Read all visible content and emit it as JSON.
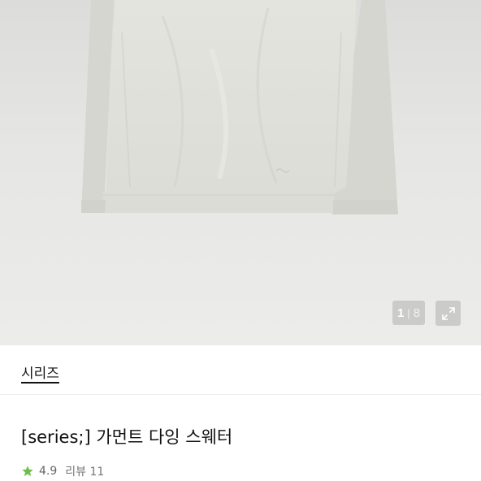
{
  "gallery": {
    "current": "1",
    "separator": "|",
    "total": "8",
    "image_icon": "sweater-product-image",
    "expand_icon": "expand-icon"
  },
  "brand": {
    "name": "시리즈"
  },
  "product": {
    "title": "[series;] 가먼트 다잉 스웨터"
  },
  "rating": {
    "icon": "star-icon",
    "star_color": "#6cc04a",
    "score": "4.9",
    "review_label": "리뷰 11"
  }
}
